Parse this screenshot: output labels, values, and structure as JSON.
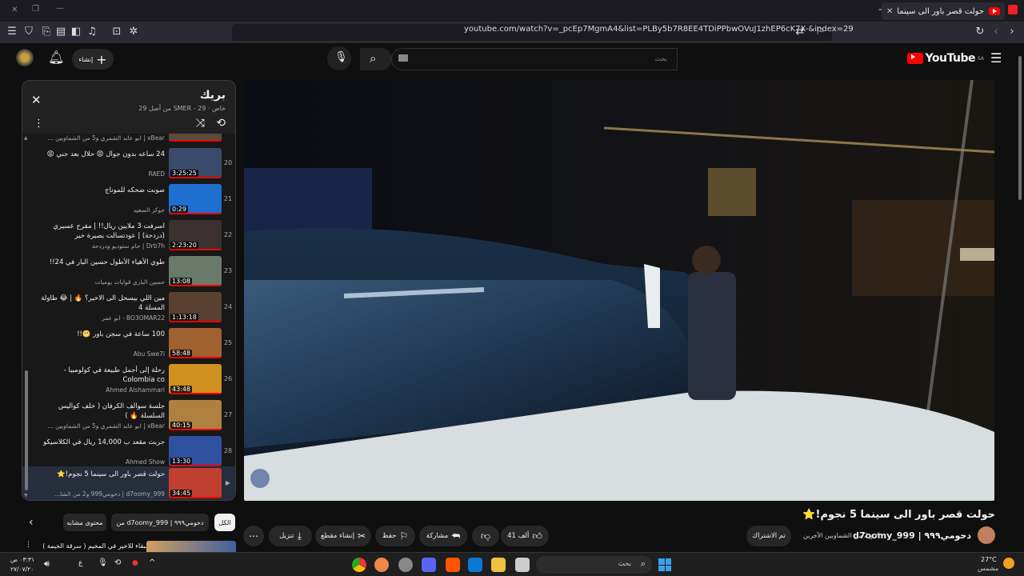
{
  "browser": {
    "tab_title": "حولت قصر باور الى سينما 5 نجوم!⭐",
    "url": "youtube.com/watch?v=_pcEp7MgmA4&list=PLBy5b7R8EE4TDiPPbwOVuJ1zhEP6cK7X-&index=29"
  },
  "youtube": {
    "logo_text": "YouTube",
    "logo_region": "SA",
    "search_placeholder": "بحث",
    "create_label": "إنشاء"
  },
  "playlist": {
    "title": "بريك",
    "subtitle": "خاص · SMER - 29 من أصل 29",
    "items": [
      {
        "index": "",
        "title": "",
        "channel": "xBear | ابو عابد الشمري و5 من الشماوبين ...",
        "duration": "",
        "color": "#5a4a3a"
      },
      {
        "index": "20",
        "title": "24 ساعه بدون جوال 😡 حلال بعد جني 😡",
        "channel": "RAED",
        "duration": "3:25:25",
        "color": "#3a4a6a"
      },
      {
        "index": "21",
        "title": "صوبت ضحكه للموناج",
        "channel": "جوكر السعيد",
        "duration": "0:29",
        "color": "#1f6fd0"
      },
      {
        "index": "22",
        "title": "اسرفت 3 ملايين ريال!! | مقرح عسيري (دردحة) | عودتسالت بصيرة خير",
        "channel": "Drb7h | حام ستوديو ودردحة",
        "duration": "2:23:20",
        "color": "#3a3030"
      },
      {
        "index": "23",
        "title": "طوي الأهياء الأطول حسين البار في 24!!",
        "channel": "حسين الباري قوايات يوميات",
        "duration": "13:08",
        "color": "#6a7a6a"
      },
      {
        "index": "24",
        "title": "مين اللي بيسحل الى الاخير؟ 🔥 | 😂 طاولة المسلة 4",
        "channel": "BO3OMAR22 - ابو عمر",
        "duration": "1:13:18",
        "color": "#5a4030"
      },
      {
        "index": "25",
        "title": "100 ساعة في سجن باور 😬!!",
        "channel": "Abu Swe7i",
        "duration": "58:48",
        "color": "#a06030"
      },
      {
        "index": "26",
        "title": "رحلة إلى أجمل طبيعة في كولومبيا - Colombia co",
        "channel": "Ahmed Alshammari",
        "duration": "43:48",
        "color": "#d09020"
      },
      {
        "index": "27",
        "title": "جلسة سوالف الكرفان ( خلف كواليس السلسلة 🔥 ) ",
        "channel": "xBear | ابو عابد الشمري و5 من الشماوبين ...",
        "duration": "40:15",
        "color": "#b08040"
      },
      {
        "index": "28",
        "title": "جربت مقعد ب 14,000 ريال في الكلاسيكو",
        "channel": "Ahmed Show",
        "duration": "13:30",
        "color": "#3050a0"
      },
      {
        "index": "▶",
        "title": "حولت قصر باور الى سينما 5 نجوم!⭐",
        "channel": "d7oomy_999 | دحومي999 و2 من الشا...",
        "duration": "34:45",
        "color": "#c04030"
      }
    ]
  },
  "video": {
    "title": "حولت قصر باور الى سينما 5 نجوم!⭐",
    "channel": "d7oomy_999 | دحومي٩٩٩",
    "collab": "و 2 من الشماوبين الآخرين",
    "subscribe_label": "تم الاشتراك",
    "likes": "41 ألف",
    "share_label": "مشاركة",
    "save_label": "حفظ",
    "clip_label": "إنشاء مقطع",
    "download_label": "تنزيل"
  },
  "chips": [
    "الكل",
    "من d7oomy_999 | دحومي٩٩٩",
    "محتوى مشابه"
  ],
  "next_rec": {
    "title": "تحدي البقاء للاخير في المخيم ( سرقة الخيمة )"
  },
  "taskbar": {
    "search_placeholder": "بحث",
    "weather_temp": "27°C",
    "weather_text": "مشمس",
    "time": "٠٣:٣١ ص",
    "date": "٢٧/٠٧/٢٠"
  }
}
